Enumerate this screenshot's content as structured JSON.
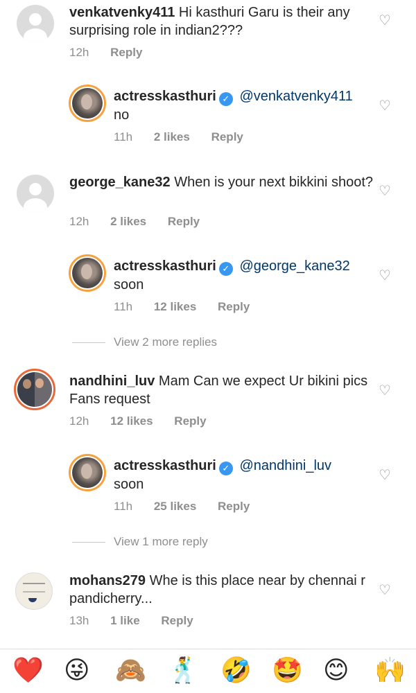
{
  "comments": [
    {
      "username": "venkatvenky411",
      "text": "Hi kasthuri Garu is their any surprising role in indian2???",
      "time": "12h",
      "likes": "",
      "reply": "Reply"
    },
    {
      "username": "actresskasthuri",
      "mention": "@venkatvenky411",
      "text": "no",
      "time": "11h",
      "likes": "2 likes",
      "reply": "Reply"
    },
    {
      "username": "george_kane32",
      "text": "When is your next bikkini shoot?",
      "time": "12h",
      "likes": "2 likes",
      "reply": "Reply"
    },
    {
      "username": "actresskasthuri",
      "mention": "@george_kane32",
      "text": "soon",
      "time": "11h",
      "likes": "12 likes",
      "reply": "Reply"
    },
    {
      "username": "nandhini_luv",
      "text": "Mam Can we expect Ur bikini pics Fans request",
      "time": "12h",
      "likes": "12 likes",
      "reply": "Reply"
    },
    {
      "username": "actresskasthuri",
      "mention": "@nandhini_luv",
      "text": "soon",
      "time": "11h",
      "likes": "25 likes",
      "reply": "Reply"
    },
    {
      "username": "mohans279",
      "text": "Whe is this place near by chennai r pandicherry...",
      "time": "13h",
      "likes": "1 like",
      "reply": "Reply"
    }
  ],
  "view_more_2": "View 2 more replies",
  "view_more_1": "View 1 more reply",
  "verified_mark": "✓",
  "heart_icon": "♡",
  "emojis": [
    "❤️",
    "😜",
    "🙈",
    "🕺",
    "🤣",
    "🤩",
    "😊",
    "🙌"
  ]
}
